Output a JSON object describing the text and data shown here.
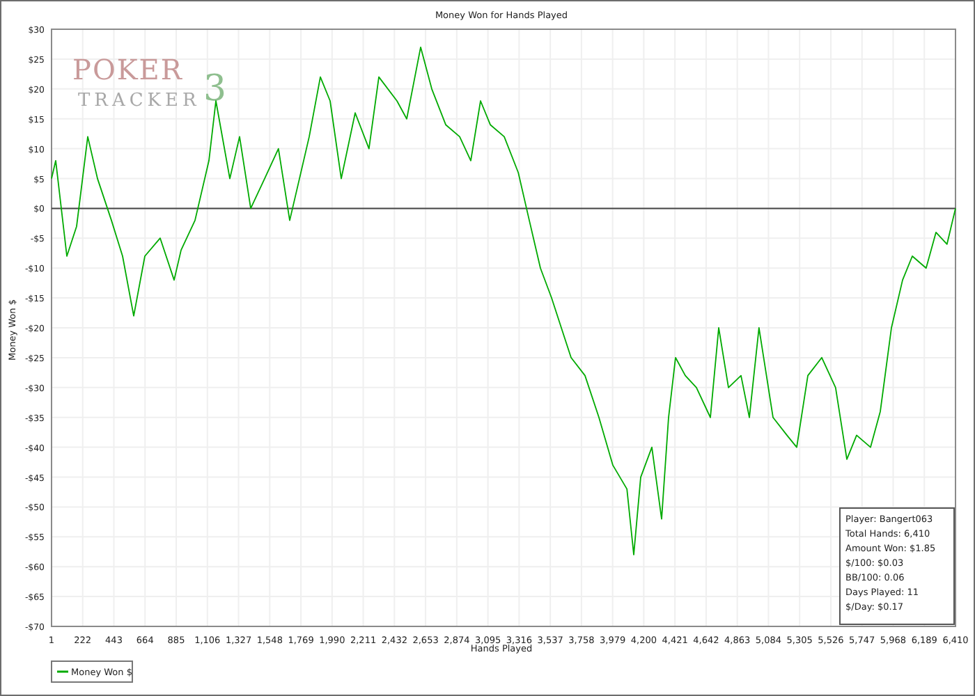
{
  "chart": {
    "logo": {
      "word1": "POKER",
      "word2": "TRACKER",
      "mark": "3"
    },
    "info_box": [
      "Player: Bangert063",
      "Total Hands: 6,410",
      "Amount Won: $1.85",
      "$/100: $0.03",
      "BB/100: 0.06",
      "Days Played: 11",
      "$/Day: $0.17"
    ],
    "chart_data": {
      "type": "line",
      "title": "Money Won for Hands Played",
      "xlabel": "Hands Played",
      "ylabel": "Money Won $",
      "x": [
        1,
        31,
        110,
        179,
        258,
        327,
        426,
        505,
        584,
        663,
        771,
        870,
        919,
        1018,
        1117,
        1166,
        1265,
        1334,
        1413,
        1512,
        1610,
        1690,
        1759,
        1828,
        1907,
        1976,
        2055,
        2154,
        2252,
        2322,
        2450,
        2519,
        2618,
        2697,
        2796,
        2894,
        2973,
        3043,
        3112,
        3210,
        3310,
        3388,
        3467,
        3546,
        3615,
        3684,
        3783,
        3882,
        3981,
        4080,
        4129,
        4178,
        4257,
        4326,
        4376,
        4425,
        4494,
        4573,
        4672,
        4731,
        4800,
        4889,
        4948,
        5017,
        5116,
        5215,
        5284,
        5363,
        5462,
        5560,
        5640,
        5709,
        5808,
        5877,
        5956,
        6035,
        6104,
        6202,
        6272,
        6350,
        6410
      ],
      "series": [
        {
          "name": "Money Won $",
          "color": "#00aa00",
          "values": [
            5,
            8,
            -8,
            -3,
            12,
            5,
            -2,
            -8,
            -18,
            -8,
            -5,
            -12,
            -7,
            -2,
            8,
            18,
            5,
            12,
            0,
            5,
            10,
            -2,
            5,
            12,
            22,
            18,
            5,
            16,
            10,
            22,
            18,
            15,
            27,
            20,
            14,
            12,
            8,
            18,
            14,
            12,
            6,
            -2,
            -10,
            -15,
            -20,
            -25,
            -28,
            -35,
            -43,
            -47,
            -58,
            -45,
            -40,
            -52,
            -35,
            -25,
            -28,
            -30,
            -35,
            -20,
            -30,
            -28,
            -35,
            -20,
            -35,
            -38,
            -40,
            -28,
            -25,
            -30,
            -42,
            -38,
            -40,
            -34,
            -20,
            -12,
            -8,
            -10,
            -4,
            -6,
            0
          ]
        }
      ],
      "grid": true,
      "xlim": [
        1,
        6410
      ],
      "ylim": [
        -70,
        30
      ],
      "xticks": [
        {
          "value": 1,
          "label": "1"
        },
        {
          "value": 222,
          "label": "222"
        },
        {
          "value": 443,
          "label": "443"
        },
        {
          "value": 664,
          "label": "664"
        },
        {
          "value": 885,
          "label": "885"
        },
        {
          "value": 1106,
          "label": "1,106"
        },
        {
          "value": 1327,
          "label": "1,327"
        },
        {
          "value": 1548,
          "label": "1,548"
        },
        {
          "value": 1769,
          "label": "1,769"
        },
        {
          "value": 1990,
          "label": "1,990"
        },
        {
          "value": 2211,
          "label": "2,211"
        },
        {
          "value": 2432,
          "label": "2,432"
        },
        {
          "value": 2653,
          "label": "2,653"
        },
        {
          "value": 2874,
          "label": "2,874"
        },
        {
          "value": 3095,
          "label": "3,095"
        },
        {
          "value": 3316,
          "label": "3,316"
        },
        {
          "value": 3537,
          "label": "3,537"
        },
        {
          "value": 3758,
          "label": "3,758"
        },
        {
          "value": 3979,
          "label": "3,979"
        },
        {
          "value": 4200,
          "label": "4,200"
        },
        {
          "value": 4421,
          "label": "4,421"
        },
        {
          "value": 4642,
          "label": "4,642"
        },
        {
          "value": 4863,
          "label": "4,863"
        },
        {
          "value": 5084,
          "label": "5,084"
        },
        {
          "value": 5305,
          "label": "5,305"
        },
        {
          "value": 5526,
          "label": "5,526"
        },
        {
          "value": 5747,
          "label": "5,747"
        },
        {
          "value": 5968,
          "label": "5,968"
        },
        {
          "value": 6189,
          "label": "6,189"
        },
        {
          "value": 6410,
          "label": "6,410"
        }
      ],
      "yticks": [
        {
          "value": 30,
          "label": "$30"
        },
        {
          "value": 25,
          "label": "$25"
        },
        {
          "value": 20,
          "label": "$20"
        },
        {
          "value": 15,
          "label": "$15"
        },
        {
          "value": 10,
          "label": "$10"
        },
        {
          "value": 5,
          "label": "$5"
        },
        {
          "value": 0,
          "label": "$0"
        },
        {
          "value": -5,
          "label": "-$5"
        },
        {
          "value": -10,
          "label": "-$10"
        },
        {
          "value": -15,
          "label": "-$15"
        },
        {
          "value": -20,
          "label": "-$20"
        },
        {
          "value": -25,
          "label": "-$25"
        },
        {
          "value": -30,
          "label": "-$30"
        },
        {
          "value": -35,
          "label": "-$35"
        },
        {
          "value": -40,
          "label": "-$40"
        },
        {
          "value": -45,
          "label": "-$45"
        },
        {
          "value": -50,
          "label": "-$50"
        },
        {
          "value": -55,
          "label": "-$55"
        },
        {
          "value": -60,
          "label": "-$60"
        },
        {
          "value": -65,
          "label": "-$65"
        },
        {
          "value": -70,
          "label": "-$70"
        }
      ]
    }
  }
}
